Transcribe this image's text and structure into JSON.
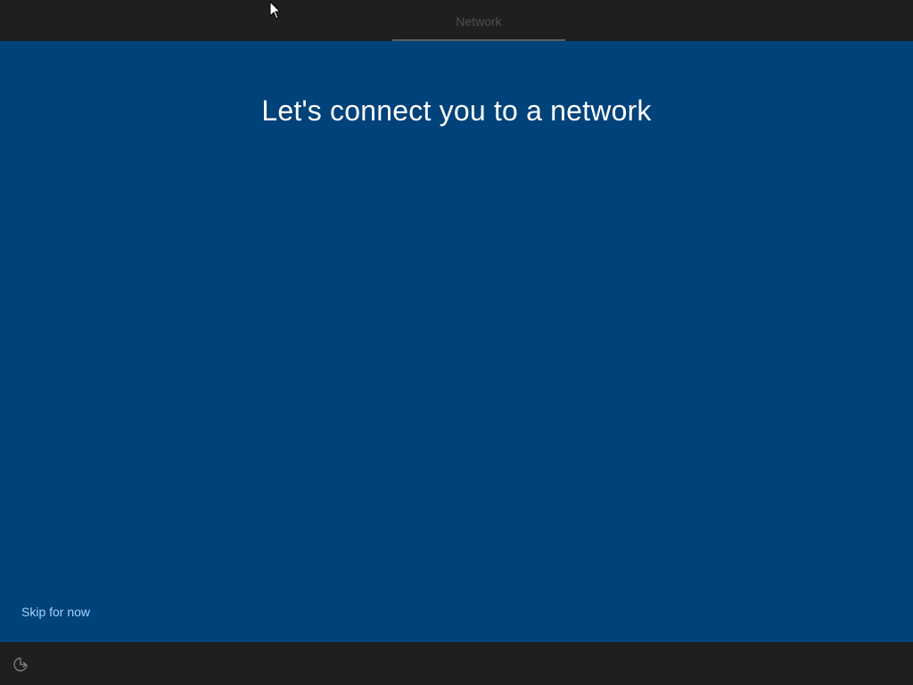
{
  "header": {
    "active_tab_label": "Network"
  },
  "main": {
    "title": "Let's connect you to a network",
    "skip_label": "Skip for now"
  },
  "footer": {
    "accessibility_icon": "ease-of-access-icon"
  },
  "colors": {
    "background_blue": "#00427a",
    "bar_dark": "#1f1f1f",
    "link": "#9fd3ff"
  }
}
